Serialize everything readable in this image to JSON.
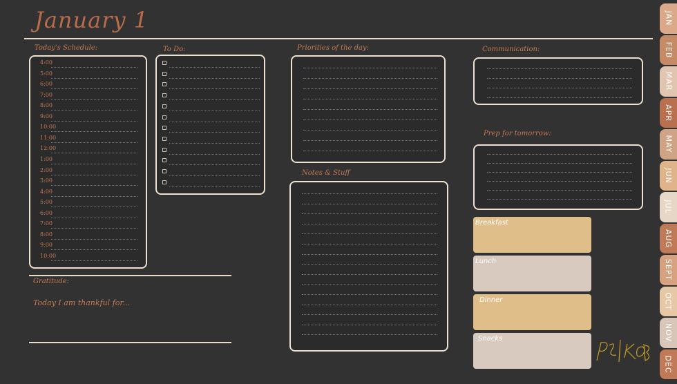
{
  "header": {
    "title": "January 1"
  },
  "schedule": {
    "label": "Today's Schedule:",
    "times": [
      "4:00",
      "5:00",
      "6:00",
      "7:00",
      "8:00",
      "9:00",
      "10:00",
      "11:00",
      "12:00",
      "1:00",
      "2:00",
      "3:00",
      "4:00",
      "5:00",
      "6:00",
      "7:00",
      "8:00",
      "9:00",
      "10:00"
    ]
  },
  "todo": {
    "label": "To Do:",
    "count": 12
  },
  "priorities": {
    "label": "Priorities of the day:"
  },
  "notes": {
    "label": "Notes & Stuff"
  },
  "communication": {
    "label": "Communication:"
  },
  "prep": {
    "label": "Prep for tomorrow:"
  },
  "gratitude": {
    "label": "Gratitude:",
    "prompt": "Today I am thankful for..."
  },
  "meals": [
    {
      "label": "Breakfast",
      "color": "#dfbe8a"
    },
    {
      "label": "Lunch",
      "color": "#d8cabf"
    },
    {
      "label": "Dinner",
      "color": "#dfbe8a"
    },
    {
      "label": "Snacks",
      "color": "#d8cabf"
    }
  ],
  "months": [
    {
      "label": "JAN",
      "color": "#d9a989"
    },
    {
      "label": "FEB",
      "color": "#c58a66"
    },
    {
      "label": "MAR",
      "color": "#e1c5b0"
    },
    {
      "label": "APR",
      "color": "#b8704f"
    },
    {
      "label": "MAY",
      "color": "#cfa385"
    },
    {
      "label": "JUN",
      "color": "#dfb48a"
    },
    {
      "label": "JUL",
      "color": "#e6d7c7"
    },
    {
      "label": "AUG",
      "color": "#bf7a57"
    },
    {
      "label": "SEPT",
      "color": "#d6a27f"
    },
    {
      "label": "OCT",
      "color": "#e6c7a6"
    },
    {
      "label": "NOV",
      "color": "#d8c6b8"
    },
    {
      "label": "DEC",
      "color": "#c07a57"
    }
  ],
  "signature": "PS|KOB",
  "colors": {
    "background": "#323232",
    "accent": "#c37a55",
    "border": "#ede2d1"
  }
}
